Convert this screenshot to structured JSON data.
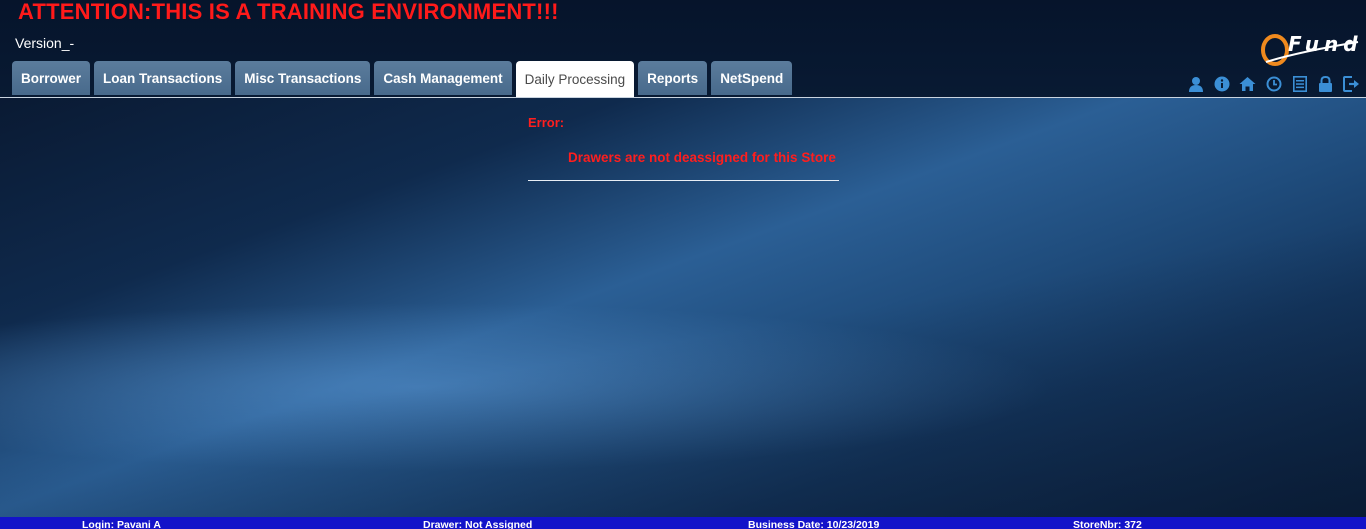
{
  "header": {
    "attention": "ATTENTION:THIS IS A TRAINING ENVIRONMENT!!!",
    "version": "Version_-",
    "logo_text": "Fund"
  },
  "tabs": [
    {
      "label": "Borrower",
      "active": false
    },
    {
      "label": "Loan Transactions",
      "active": false
    },
    {
      "label": "Misc Transactions",
      "active": false
    },
    {
      "label": "Cash Management",
      "active": false
    },
    {
      "label": "Daily Processing",
      "active": true
    },
    {
      "label": "Reports",
      "active": false
    },
    {
      "label": "NetSpend",
      "active": false
    }
  ],
  "toolbar_icons": [
    "user-icon",
    "info-icon",
    "home-icon",
    "clock-icon",
    "document-icon",
    "lock-icon",
    "logout-icon"
  ],
  "error": {
    "label": "Error:",
    "message": "Drawers are not deassigned for this Store"
  },
  "footer": {
    "login": "Login: Pavani A",
    "drawer": "Drawer: Not Assigned",
    "business_date": "Business Date: 10/23/2019",
    "store": "StoreNbr: 372"
  },
  "colors": {
    "attention": "#ff1a1a",
    "error": "#ff1e1e",
    "tab": "#52739a",
    "footer": "#1313c9",
    "icon": "#3b8fd6",
    "logo_orange": "#f08a1e"
  }
}
